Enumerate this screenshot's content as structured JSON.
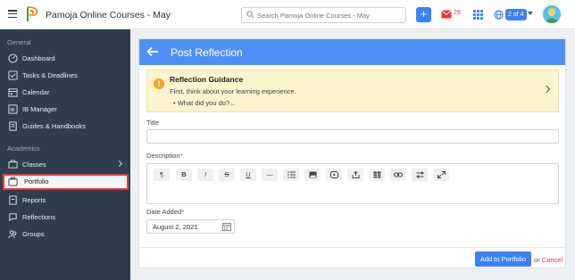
{
  "header": {
    "app_title": "Pamoja Online Courses - May",
    "search_placeholder": "Search Pamoja Online Courses - May",
    "mail_count": "29",
    "pager": "2 of 4",
    "plus_label": "+"
  },
  "sidebar": {
    "section_general": "General",
    "section_academics": "Academics",
    "items": [
      {
        "label": "Dashboard",
        "icon": "dashboard-icon"
      },
      {
        "label": "Tasks & Deadlines",
        "icon": "tasks-icon"
      },
      {
        "label": "Calendar",
        "icon": "calendar-icon"
      },
      {
        "label": "IB Manager",
        "icon": "ib-manager-icon"
      },
      {
        "label": "Guides & Handbooks",
        "icon": "guides-icon"
      },
      {
        "label": "Classes",
        "icon": "classes-icon"
      },
      {
        "label": "Portfolio",
        "icon": "portfolio-icon",
        "active": true
      },
      {
        "label": "Reports",
        "icon": "reports-icon"
      },
      {
        "label": "Reflections",
        "icon": "reflections-icon"
      },
      {
        "label": "Groups",
        "icon": "groups-icon"
      }
    ]
  },
  "main": {
    "title": "Post Reflection",
    "guidance": {
      "title": "Reflection Guidance",
      "text": "First, think about your learning experience.",
      "bullet": "What did you do?..."
    },
    "fields": {
      "title_label": "Title",
      "description_label": "Description",
      "date_label": "Date Added",
      "date_value": "August 2, 2021",
      "required_mark": "*"
    },
    "toolbar": [
      "¶",
      "B",
      "I",
      "S",
      "U",
      "—",
      "list",
      "image",
      "video",
      "upload",
      "table",
      "link",
      "swap",
      "expand"
    ],
    "add_button": "Add to Portfolio",
    "or_text": "or",
    "cancel": "Cancel"
  },
  "colors": {
    "accent": "#3b82f6",
    "header_bar": "#4e90f5",
    "sidebar_bg": "#2f3e4e",
    "guidance_bg": "#fdf3cf",
    "active_outline": "#e53935"
  }
}
